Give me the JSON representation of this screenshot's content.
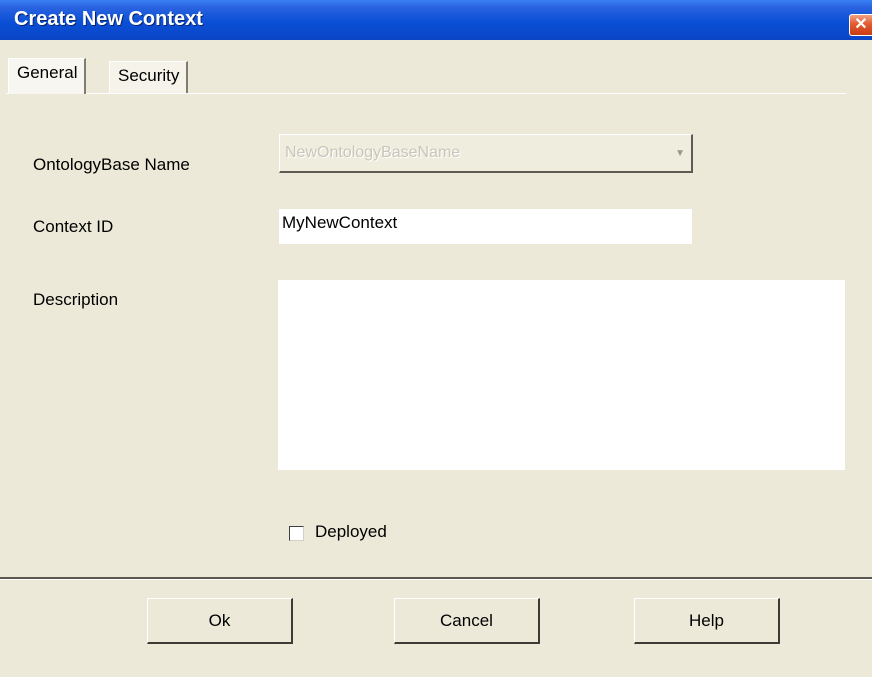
{
  "window": {
    "title": "Create New Context",
    "close_glyph": "✕"
  },
  "tabs": [
    {
      "label": "General",
      "active": true
    },
    {
      "label": "Security",
      "active": false
    }
  ],
  "form": {
    "ontology_label": "OntologyBase Name",
    "ontology_value": "NewOntologyBaseName",
    "ontology_dropdown_icon": "chevron-down-icon",
    "context_id_label": "Context ID",
    "context_id_value": "MyNewContext",
    "description_label": "Description",
    "description_value": "",
    "deployed_label": "Deployed",
    "deployed_checked": false
  },
  "buttons": {
    "ok": "Ok",
    "cancel": "Cancel",
    "help": "Help"
  },
  "colors": {
    "titlebar": "#0b4fd6",
    "dialog_background": "#ece9d8",
    "close_button": "#e35b2f"
  }
}
